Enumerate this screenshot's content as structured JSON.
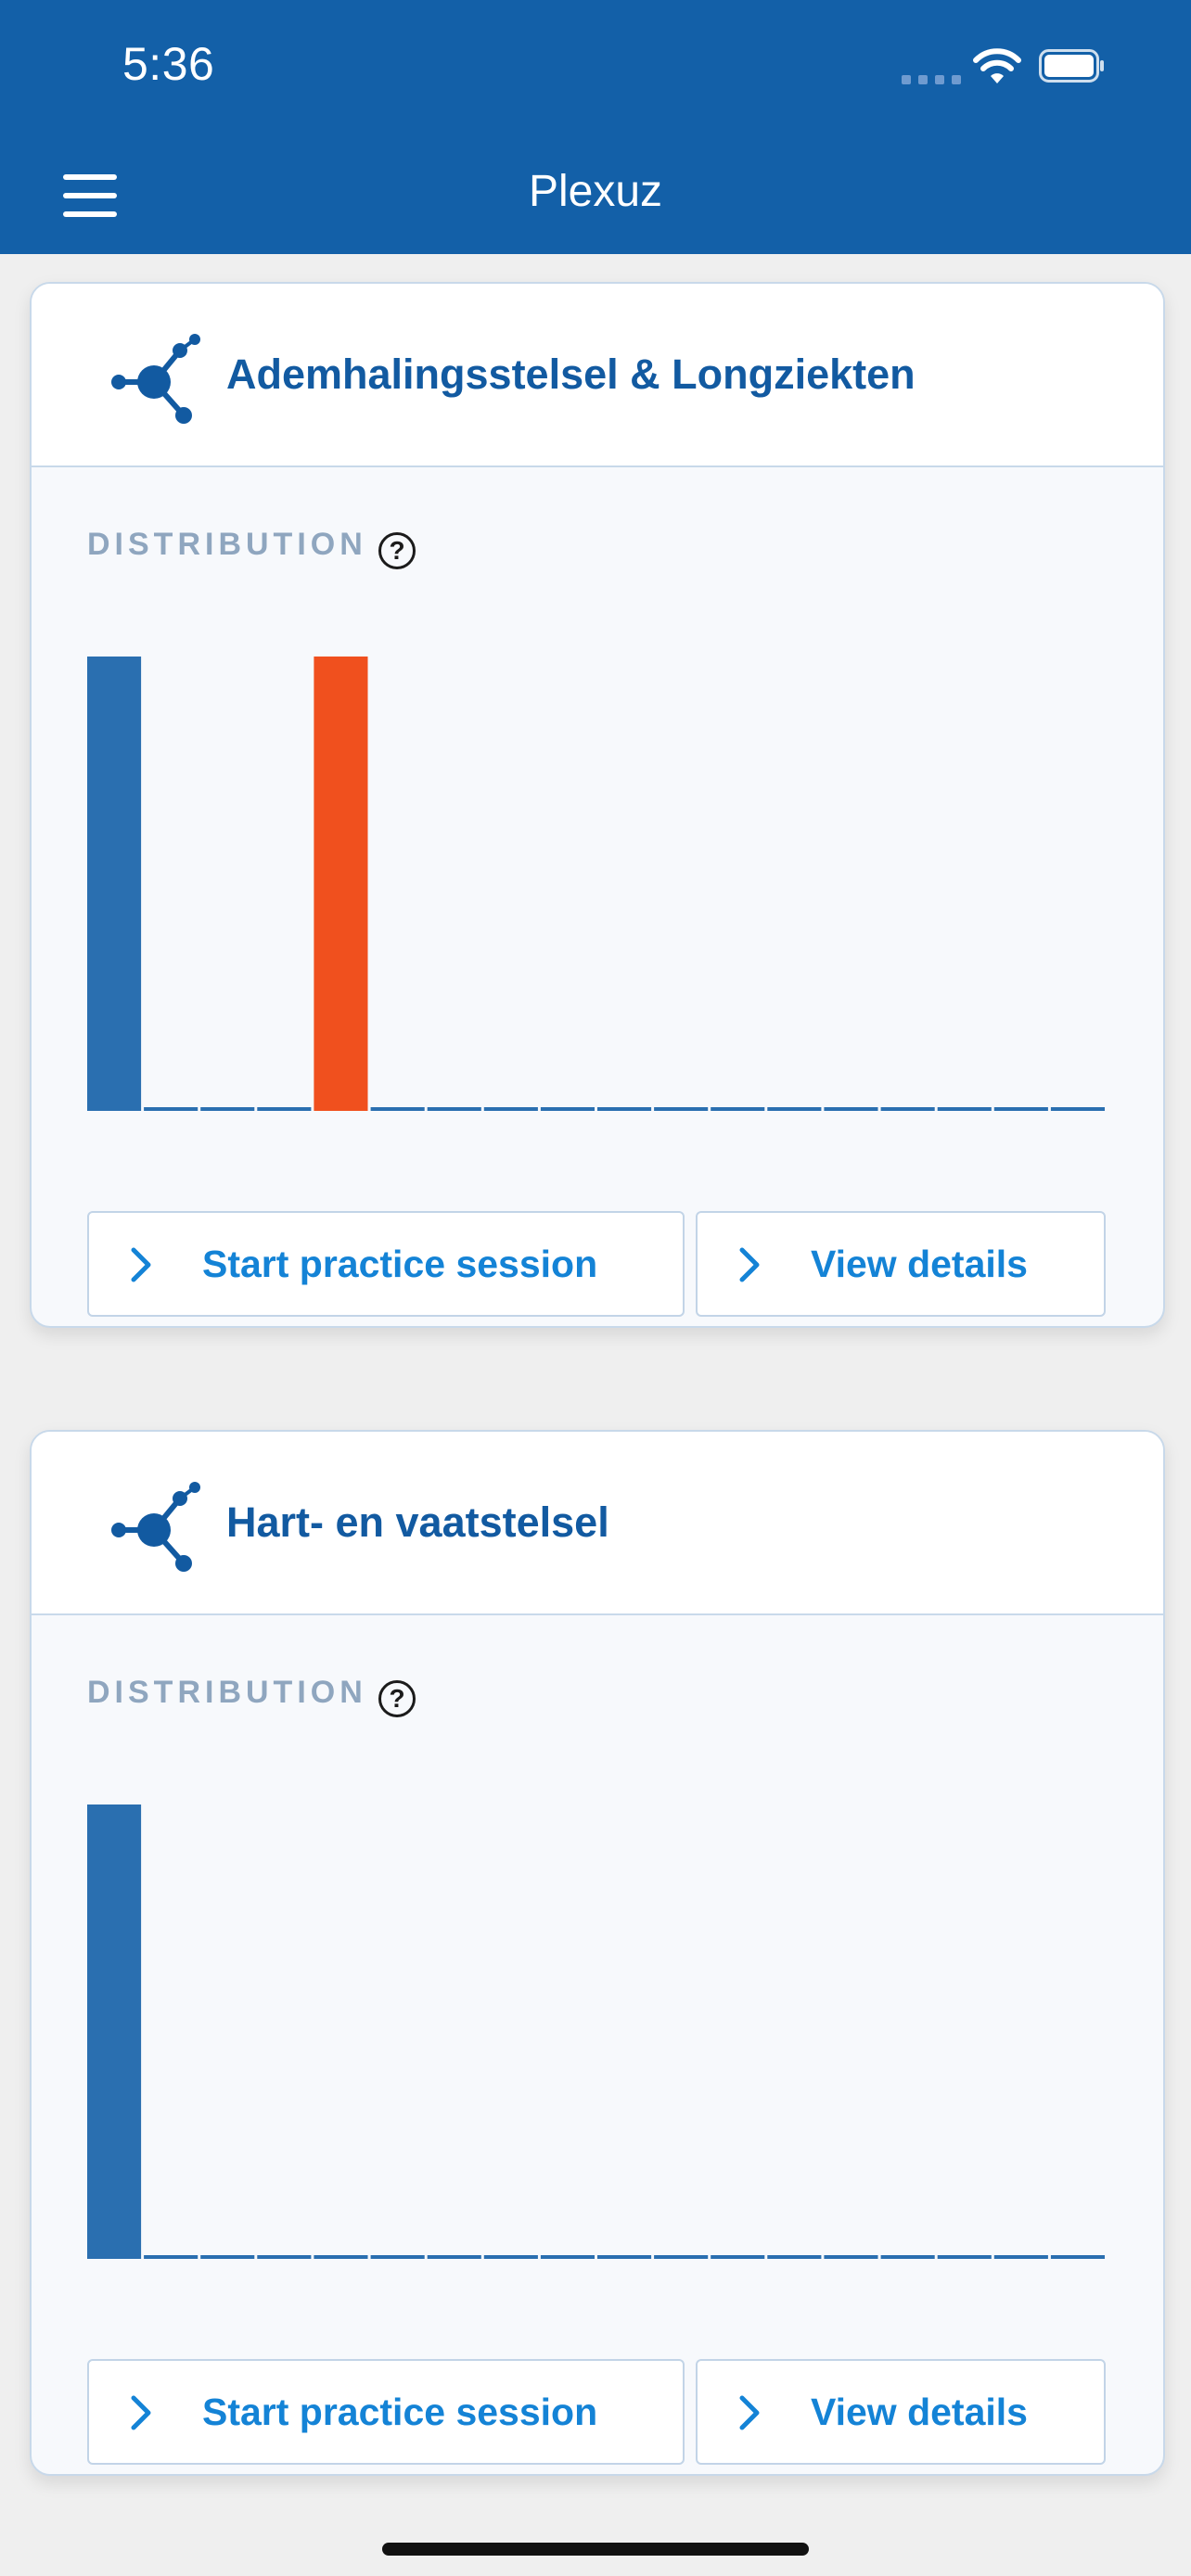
{
  "status_bar": {
    "time": "5:36"
  },
  "app_bar": {
    "title": "Plexuz",
    "menu_icon": "hamburger-icon"
  },
  "colors": {
    "brand": "#1360a8",
    "bar_primary": "#2a6fb0",
    "bar_highlight": "#f0501e",
    "button_text": "#1483d6"
  },
  "cards": [
    {
      "title": "Ademhalingsstelsel & Longziekten",
      "distribution_label": "DISTRIBUTION",
      "help_label": "?",
      "start_label": "Start practice session",
      "details_label": "View details",
      "chart_data": {
        "type": "bar",
        "bins": 18,
        "values": [
          1,
          0,
          0,
          0,
          1,
          0,
          0,
          0,
          0,
          0,
          0,
          0,
          0,
          0,
          0,
          0,
          0,
          0
        ],
        "highlight_index": 4,
        "ylim": [
          0,
          1
        ]
      }
    },
    {
      "title": "Hart- en vaatstelsel",
      "distribution_label": "DISTRIBUTION",
      "help_label": "?",
      "start_label": "Start practice session",
      "details_label": "View details",
      "chart_data": {
        "type": "bar",
        "bins": 18,
        "values": [
          1,
          0,
          0,
          0,
          0,
          0,
          0,
          0,
          0,
          0,
          0,
          0,
          0,
          0,
          0,
          0,
          0,
          0
        ],
        "highlight_index": -1,
        "ylim": [
          0,
          1
        ]
      }
    }
  ]
}
